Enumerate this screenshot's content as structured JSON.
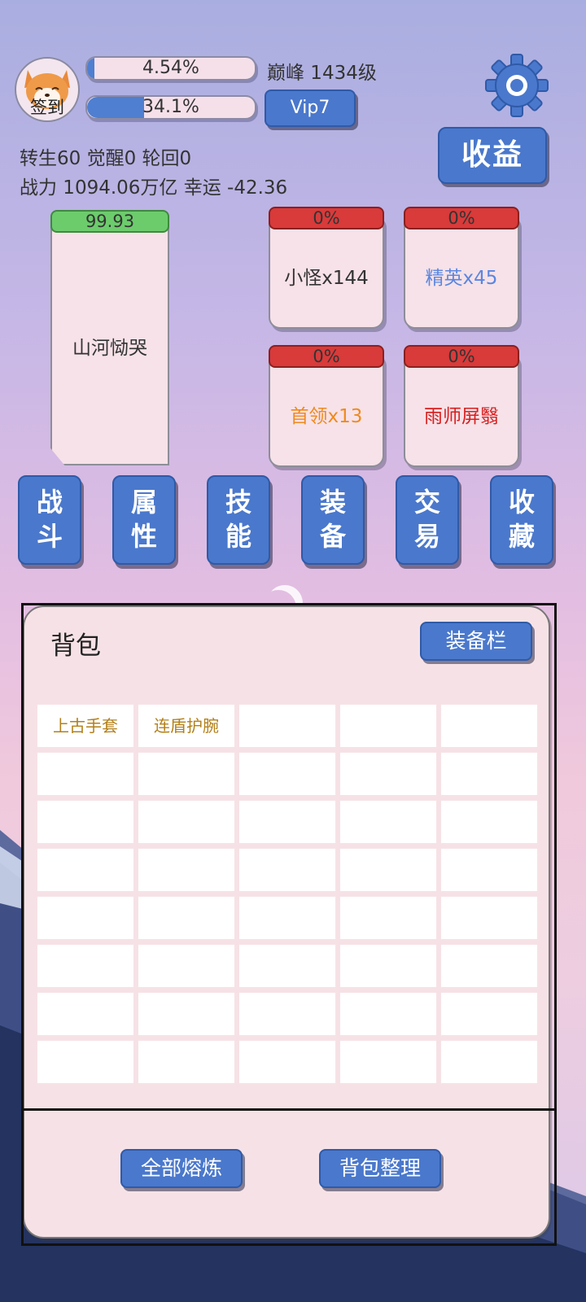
{
  "header": {
    "avatar_label": "签到",
    "exp_bar": {
      "text": "4.54%",
      "progress": 0.0454
    },
    "second_bar": {
      "text": "34.1%",
      "progress": 0.341
    },
    "peak_level": "巅峰 1434级",
    "vip_label": "Vip7",
    "income_label": "收益",
    "stats_line1": "转生60 觉醒0 轮回0",
    "stats_line2": "战力 1094.06万亿  幸运 -42.36"
  },
  "boss_card": {
    "hp": "99.93",
    "name": "山河恸哭"
  },
  "mini_cards": [
    {
      "pct": "0%",
      "name": "小怪x144",
      "color": "#333333"
    },
    {
      "pct": "0%",
      "name": "精英x45",
      "color": "#5b86e0"
    },
    {
      "pct": "0%",
      "name": "首领x13",
      "color": "#f08a1e"
    },
    {
      "pct": "0%",
      "name": "雨师屏翳",
      "color": "#d81e1e"
    }
  ],
  "nav": [
    {
      "c1": "战",
      "c2": "斗"
    },
    {
      "c1": "属",
      "c2": "性"
    },
    {
      "c1": "技",
      "c2": "能"
    },
    {
      "c1": "装",
      "c2": "备"
    },
    {
      "c1": "交",
      "c2": "易"
    },
    {
      "c1": "收",
      "c2": "藏"
    }
  ],
  "backpack": {
    "title": "背包",
    "equip_button": "装备栏",
    "items": [
      "上古手套",
      "连盾护腕"
    ],
    "smelt_all": "全部熔炼",
    "sort": "背包整理"
  },
  "colors": {
    "accent": "#4a78cc",
    "hp_green": "#6ccc6c",
    "alert_red": "#d93a3a"
  },
  "icons": {
    "settings": "gear-icon",
    "avatar": "shiba-dog-icon"
  }
}
